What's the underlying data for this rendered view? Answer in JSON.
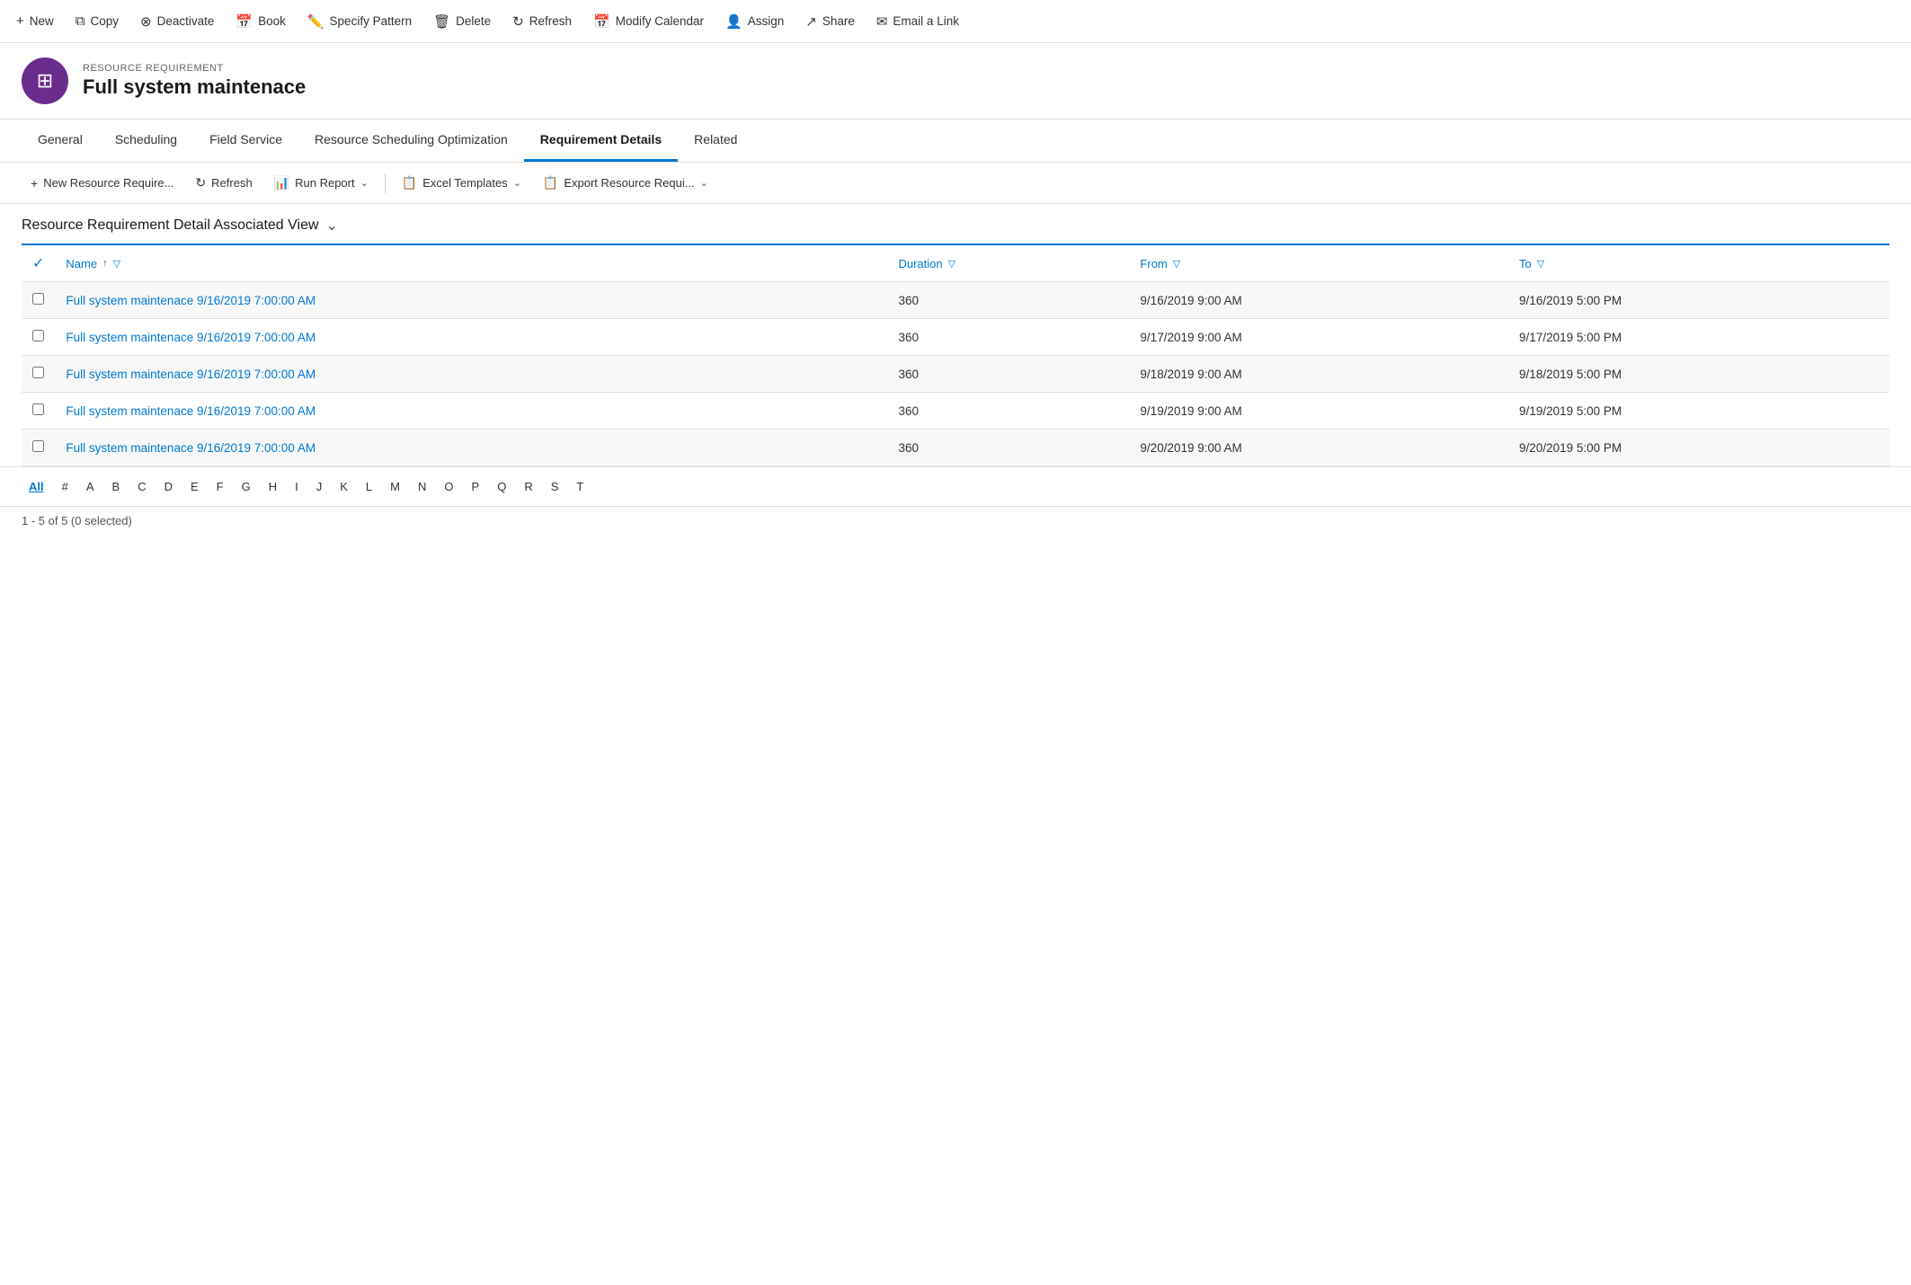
{
  "toolbar": {
    "buttons": [
      {
        "id": "new",
        "label": "New",
        "icon": "+"
      },
      {
        "id": "copy",
        "label": "Copy",
        "icon": "⧉"
      },
      {
        "id": "deactivate",
        "label": "Deactivate",
        "icon": "⊗"
      },
      {
        "id": "book",
        "label": "Book",
        "icon": "📅"
      },
      {
        "id": "specify-pattern",
        "label": "Specify Pattern",
        "icon": "✏️"
      },
      {
        "id": "delete",
        "label": "Delete",
        "icon": "🗑"
      },
      {
        "id": "refresh",
        "label": "Refresh",
        "icon": "↻"
      },
      {
        "id": "modify-calendar",
        "label": "Modify Calendar",
        "icon": "📅"
      },
      {
        "id": "assign",
        "label": "Assign",
        "icon": "👤"
      },
      {
        "id": "share",
        "label": "Share",
        "icon": "↗"
      },
      {
        "id": "email-a-link",
        "label": "Email a Link",
        "icon": "✉"
      }
    ]
  },
  "record": {
    "subtitle": "Resource Requirement",
    "title": "Full system maintenace",
    "avatar_icon": "⊞"
  },
  "nav_tabs": [
    {
      "id": "general",
      "label": "General",
      "active": false
    },
    {
      "id": "scheduling",
      "label": "Scheduling",
      "active": false
    },
    {
      "id": "field-service",
      "label": "Field Service",
      "active": false
    },
    {
      "id": "rso",
      "label": "Resource Scheduling Optimization",
      "active": false
    },
    {
      "id": "requirement-details",
      "label": "Requirement Details",
      "active": true
    },
    {
      "id": "related",
      "label": "Related",
      "active": false
    }
  ],
  "sub_toolbar": {
    "buttons": [
      {
        "id": "new-resource-req",
        "label": "New Resource Require...",
        "icon": "+",
        "has_chevron": false
      },
      {
        "id": "refresh",
        "label": "Refresh",
        "icon": "↻",
        "has_chevron": false
      },
      {
        "id": "run-report",
        "label": "Run Report",
        "icon": "📊",
        "has_chevron": true
      },
      {
        "id": "excel-templates",
        "label": "Excel Templates",
        "icon": "📋",
        "has_chevron": true
      },
      {
        "id": "export",
        "label": "Export Resource Requi...",
        "icon": "📋",
        "has_chevron": true
      }
    ]
  },
  "view_title": "Resource Requirement Detail Associated View",
  "table": {
    "columns": [
      {
        "id": "name",
        "label": "Name",
        "has_sort": true,
        "has_filter": true
      },
      {
        "id": "duration",
        "label": "Duration",
        "has_sort": false,
        "has_filter": true
      },
      {
        "id": "from",
        "label": "From",
        "has_sort": false,
        "has_filter": true
      },
      {
        "id": "to",
        "label": "To",
        "has_sort": false,
        "has_filter": true
      }
    ],
    "rows": [
      {
        "name": "Full system maintenace 9/16/2019 7:00:00 AM",
        "duration": "360",
        "from": "9/16/2019 9:00 AM",
        "to": "9/16/2019 5:00 PM"
      },
      {
        "name": "Full system maintenace 9/16/2019 7:00:00 AM",
        "duration": "360",
        "from": "9/17/2019 9:00 AM",
        "to": "9/17/2019 5:00 PM"
      },
      {
        "name": "Full system maintenace 9/16/2019 7:00:00 AM",
        "duration": "360",
        "from": "9/18/2019 9:00 AM",
        "to": "9/18/2019 5:00 PM"
      },
      {
        "name": "Full system maintenace 9/16/2019 7:00:00 AM",
        "duration": "360",
        "from": "9/19/2019 9:00 AM",
        "to": "9/19/2019 5:00 PM"
      },
      {
        "name": "Full system maintenace 9/16/2019 7:00:00 AM",
        "duration": "360",
        "from": "9/20/2019 9:00 AM",
        "to": "9/20/2019 5:00 PM"
      }
    ]
  },
  "pagination": {
    "letters": [
      "All",
      "#",
      "A",
      "B",
      "C",
      "D",
      "E",
      "F",
      "G",
      "H",
      "I",
      "J",
      "K",
      "L",
      "M",
      "N",
      "O",
      "P",
      "Q",
      "R",
      "S",
      "T"
    ],
    "active": "All"
  },
  "status": "1 - 5 of 5 (0 selected)"
}
